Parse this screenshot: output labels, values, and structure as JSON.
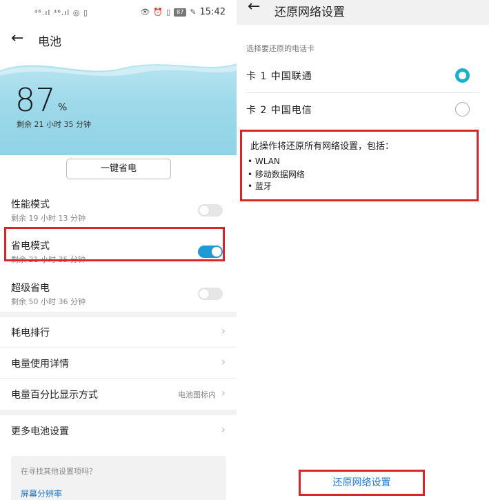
{
  "left": {
    "statusbar": {
      "signal_left": "⁴⁶.ıl ⁴⁶.ıl ◎ ▯",
      "battery": "87",
      "time": "15:42"
    },
    "header": {
      "title": "电池"
    },
    "battery": {
      "percent": "87",
      "unit": "%",
      "remaining": "剩余 21 小时 35 分钟"
    },
    "save_button": "一键省电",
    "modes": [
      {
        "name": "性能模式",
        "sub": "剩余 19 小时 13 分钟",
        "enabled": false
      },
      {
        "name": "省电模式",
        "sub": "剩余 21 小时 35 分钟",
        "enabled": true
      },
      {
        "name": "超级省电",
        "sub": "剩余 50 小时 36 分钟",
        "enabled": false
      }
    ],
    "rows": [
      {
        "label": "耗电排行",
        "value": ""
      },
      {
        "label": "电量使用详情",
        "value": ""
      },
      {
        "label": "电量百分比显示方式",
        "value": "电池图标内"
      }
    ],
    "more": {
      "label": "更多电池设置"
    },
    "hint": {
      "question": "在寻找其他设置项吗？",
      "link": "屏幕分辨率"
    }
  },
  "right": {
    "header": {
      "title": "还原网络设置"
    },
    "select_label": "选择要还原的电话卡",
    "sims": [
      {
        "label": "卡 1 中国联通",
        "selected": true
      },
      {
        "label": "卡 2 中国电信",
        "selected": false
      }
    ],
    "info": {
      "title": "此操作将还原所有网络设置，包括：",
      "items": [
        "• WLAN",
        "• 移动数据网络",
        "• 蓝牙"
      ]
    },
    "reset_button": "还原网络设置"
  },
  "colors": {
    "accent": "#1e9bd7",
    "radio": "#1bb2c9",
    "highlight": "#d7262b",
    "link": "#1e7bd0"
  },
  "icons": {
    "back": "arrow-left-icon",
    "chevron": "chevron-right-icon"
  }
}
